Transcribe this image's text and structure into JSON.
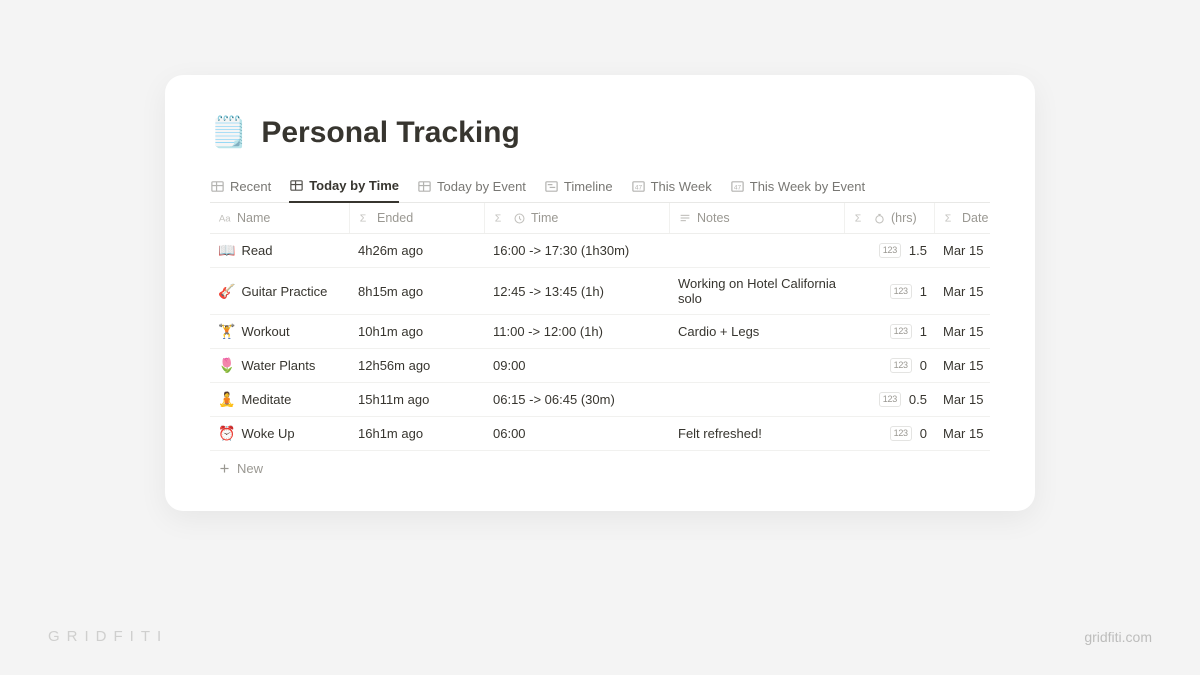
{
  "page": {
    "icon": "🗒️",
    "title": "Personal Tracking"
  },
  "tabs": [
    {
      "label": "Recent",
      "icon": "table",
      "active": false
    },
    {
      "label": "Today by Time",
      "icon": "table",
      "active": true
    },
    {
      "label": "Today by Event",
      "icon": "table",
      "active": false
    },
    {
      "label": "Timeline",
      "icon": "timeline",
      "active": false
    },
    {
      "label": "This Week",
      "icon": "number",
      "active": false
    },
    {
      "label": "This Week by Event",
      "icon": "number",
      "active": false
    }
  ],
  "columns": {
    "name": "Name",
    "ended": "Ended",
    "time": "Time",
    "notes": "Notes",
    "hrs": "(hrs)",
    "date": "Date"
  },
  "rows": [
    {
      "emoji": "📖",
      "name": "Read",
      "ended": "4h26m ago",
      "time": "16:00 -> 17:30 (1h30m)",
      "notes": "",
      "hrs": "1.5",
      "date": "Mar 15"
    },
    {
      "emoji": "🎸",
      "name": "Guitar Practice",
      "ended": "8h15m ago",
      "time": "12:45 -> 13:45 (1h)",
      "notes": "Working on Hotel California solo",
      "hrs": "1",
      "date": "Mar 15"
    },
    {
      "emoji": "🏋️",
      "name": "Workout",
      "ended": "10h1m ago",
      "time": "11:00 -> 12:00 (1h)",
      "notes": "Cardio + Legs",
      "hrs": "1",
      "date": "Mar 15"
    },
    {
      "emoji": "🌷",
      "name": "Water Plants",
      "ended": "12h56m ago",
      "time": "09:00",
      "notes": "",
      "hrs": "0",
      "date": "Mar 15"
    },
    {
      "emoji": "🧘",
      "name": "Meditate",
      "ended": "15h11m ago",
      "time": "06:15 -> 06:45 (30m)",
      "notes": "",
      "hrs": "0.5",
      "date": "Mar 15"
    },
    {
      "emoji": "⏰",
      "name": "Woke Up",
      "ended": "16h1m ago",
      "time": "06:00",
      "notes": "Felt refreshed!",
      "hrs": "0",
      "date": "Mar 15"
    }
  ],
  "add_row_label": "New",
  "badge": "123",
  "watermark": {
    "left": "GRIDFITI",
    "right": "gridfiti.com"
  }
}
